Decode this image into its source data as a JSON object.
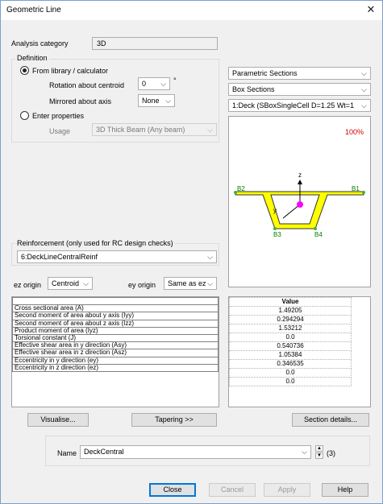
{
  "window": {
    "title": "Geometric Line"
  },
  "analysis": {
    "label": "Analysis category",
    "value": "3D"
  },
  "definition": {
    "group_label": "Definition",
    "from_library_label": "From library / calculator",
    "rotation_label": "Rotation about centroid",
    "rotation_value": "0",
    "degree_symbol": "°",
    "mirrored_label": "Mirrored about axis",
    "mirrored_value": "None",
    "enter_properties_label": "Enter properties",
    "usage_label": "Usage",
    "usage_value": "3D Thick Beam (Any beam)"
  },
  "sections": {
    "library": "Parametric Sections",
    "type": "Box Sections",
    "selected": "1:Deck (SBoxSingleCell D=1.25 Wt=1"
  },
  "preview": {
    "zoom": "100%",
    "labels": {
      "b1": "B1",
      "b2": "B2",
      "b3": "B3",
      "b4": "B4",
      "z": "z",
      "y": "y"
    },
    "colors": {
      "section_fill": "#ffff00",
      "points": "#40b040",
      "centroid": "#ff00ff",
      "zoom_text": "#d00000",
      "label_green": "#008000"
    }
  },
  "reinforcement": {
    "group_label": "Reinforcement (only used for RC design checks)",
    "value": "6:DeckLineCentralReinf"
  },
  "origins": {
    "ez_label": "ez origin",
    "ez_value": "Centroid",
    "ey_label": "ey origin",
    "ey_value": "Same as ez"
  },
  "properties": {
    "value_header": "Value",
    "rows": [
      {
        "name": "Cross sectional area (A)",
        "value": "1.49205"
      },
      {
        "name": "Second moment of area about y axis (Iyy)",
        "value": "0.294294"
      },
      {
        "name": "Second moment of area about z axis (Izz)",
        "value": "1.53212"
      },
      {
        "name": "Product moment of area (Iyz)",
        "value": "0.0"
      },
      {
        "name": "Torsional constant (J)",
        "value": "0.540736"
      },
      {
        "name": "Effective shear area in y direction (Asy)",
        "value": "1.05384"
      },
      {
        "name": "Effective shear area in z direction (Asz)",
        "value": "0.346535"
      },
      {
        "name": "Eccentricity in y direction (ey)",
        "value": "0.0"
      },
      {
        "name": "Eccentricity in z direction (ez)",
        "value": "0.0"
      }
    ]
  },
  "buttons": {
    "visualise": "Visualise...",
    "tapering": "Tapering >>",
    "section_details": "Section details...",
    "close": "Close",
    "cancel": "Cancel",
    "apply": "Apply",
    "help": "Help"
  },
  "name_field": {
    "label": "Name",
    "value": "DeckCentral",
    "count": "(3)"
  }
}
